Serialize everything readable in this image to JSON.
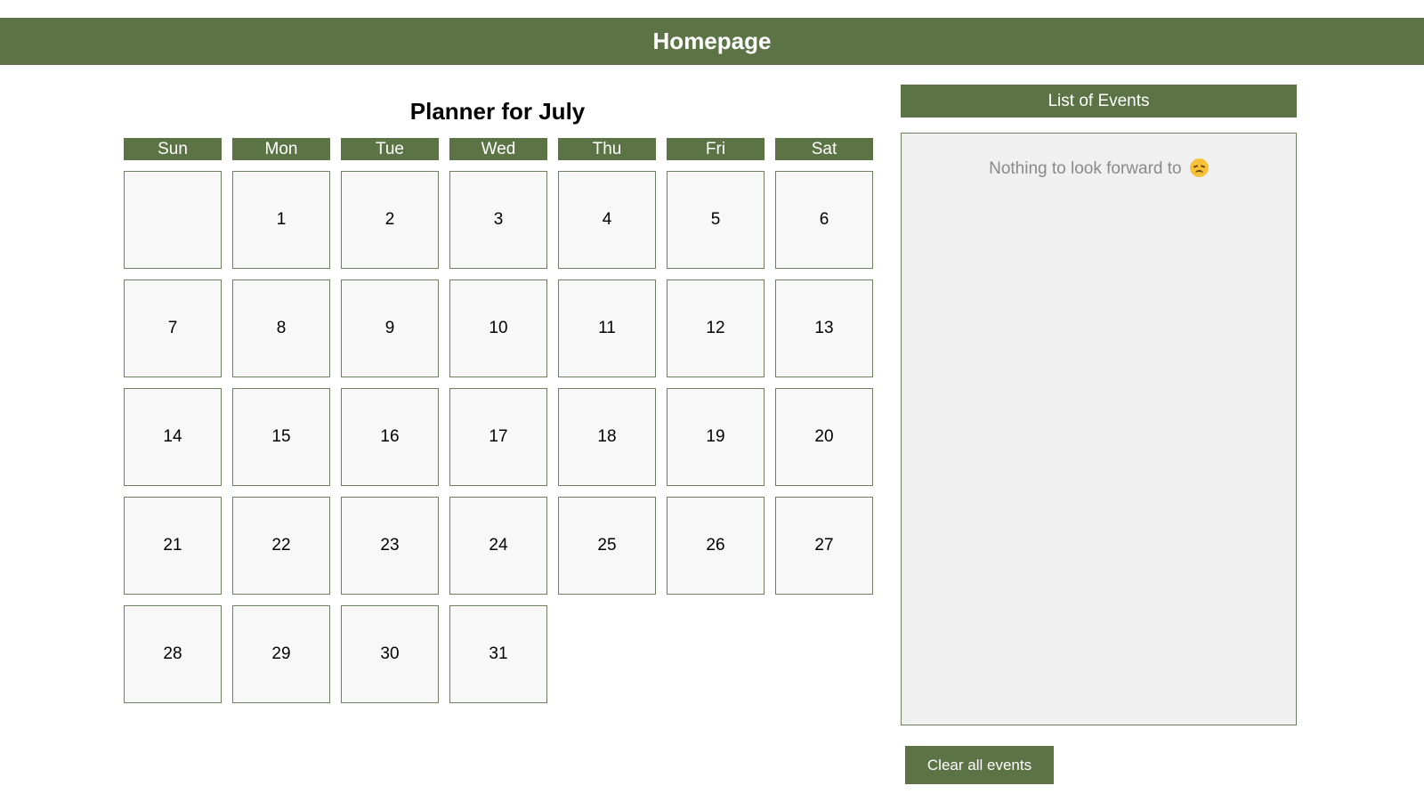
{
  "header": {
    "title": "Homepage"
  },
  "planner": {
    "title": "Planner for July",
    "weekdays": [
      "Sun",
      "Mon",
      "Tue",
      "Wed",
      "Thu",
      "Fri",
      "Sat"
    ],
    "days": [
      "",
      "1",
      "2",
      "3",
      "4",
      "5",
      "6",
      "7",
      "8",
      "9",
      "10",
      "11",
      "12",
      "13",
      "14",
      "15",
      "16",
      "17",
      "18",
      "19",
      "20",
      "21",
      "22",
      "23",
      "24",
      "25",
      "26",
      "27",
      "28",
      "29",
      "30",
      "31"
    ]
  },
  "events": {
    "title": "List of Events",
    "empty_message": "Nothing to look forward to",
    "empty_icon": "disappointed-face-icon",
    "clear_label": "Clear all events"
  },
  "colors": {
    "accent": "#5c7445",
    "cell_bg": "#f8f8f8",
    "panel_bg": "#f0f0f0"
  }
}
